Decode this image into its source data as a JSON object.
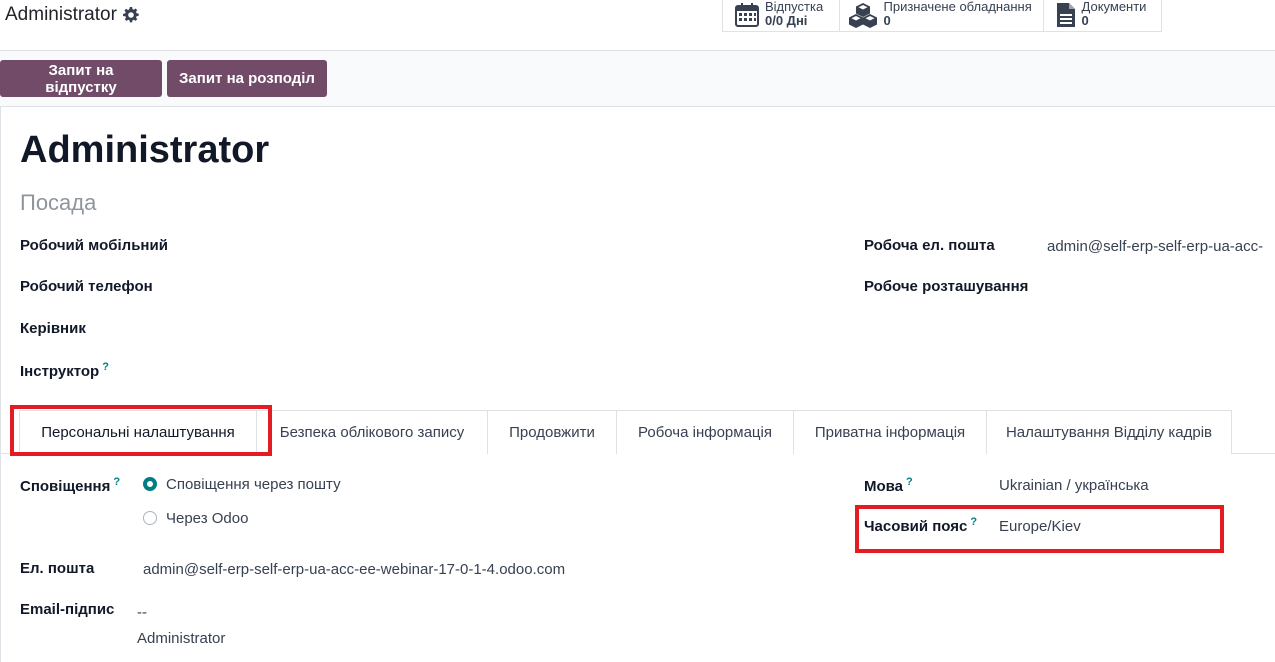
{
  "breadcrumb": {
    "title": "Administrator"
  },
  "stats": [
    {
      "icon": "calendar-icon",
      "label": "Відпустка",
      "value": "0/0 Дні"
    },
    {
      "icon": "cubes-icon",
      "label": "Призначене обладнання",
      "value": "0"
    },
    {
      "icon": "document-icon",
      "label": "Документи",
      "value": "0"
    }
  ],
  "actions": {
    "leave_request": "Запит на відпустку",
    "allocation_request": "Запит на розподіл"
  },
  "employee": {
    "name": "Administrator",
    "job_placeholder": "Посада"
  },
  "fields": {
    "work_mobile": "Робочий мобільний",
    "work_phone": "Робочий телефон",
    "manager": "Керівник",
    "coach": "Інструктор",
    "work_email_label": "Робоча ел. пошта",
    "work_email_value": "admin@self-erp-self-erp-ua-acc-",
    "work_location": "Робоче розташування"
  },
  "tabs": [
    "Персональні налаштування",
    "Безпека облікового запису",
    "Продовжити",
    "Робоча інформація",
    "Приватна інформація",
    "Налаштування Відділу кадрів"
  ],
  "prefs": {
    "notifications_label": "Сповіщення",
    "opt_email": "Сповіщення через пошту",
    "opt_odoo": "Через Odoo",
    "email_label": "Ел. пошта",
    "email_value": "admin@self-erp-self-erp-ua-acc-ee-webinar-17-0-1-4.odoo.com",
    "signature_label": "Email-підпис",
    "signature_line1": "--",
    "signature_line2": "Administrator",
    "language_label": "Мова",
    "language_value": "Ukrainian / українська",
    "timezone_label": "Часовий пояс",
    "timezone_value": "Europe/Kiev"
  },
  "help_mark": "?",
  "colors": {
    "primary": "#714b67",
    "accent": "#017e84",
    "highlight": "#e31b23"
  }
}
